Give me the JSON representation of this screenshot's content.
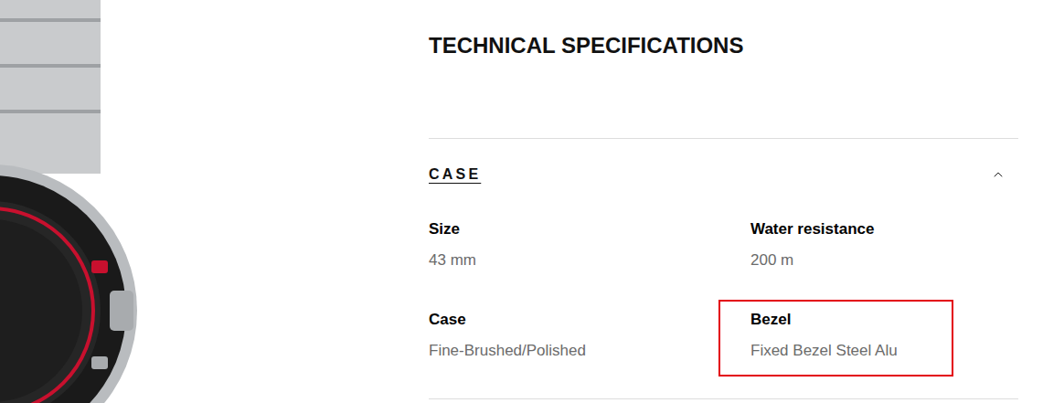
{
  "heading": "TECHNICAL SPECIFICATIONS",
  "sections": [
    {
      "title": "CASE",
      "expanded": true,
      "specs": [
        {
          "label": "Size",
          "value": "43 mm",
          "highlighted": false
        },
        {
          "label": "Water resistance",
          "value": "200 m",
          "highlighted": false
        },
        {
          "label": "Case",
          "value": "Fine-Brushed/Polished",
          "highlighted": false
        },
        {
          "label": "Bezel",
          "value": "Fixed Bezel Steel Alu",
          "highlighted": true
        }
      ]
    }
  ]
}
